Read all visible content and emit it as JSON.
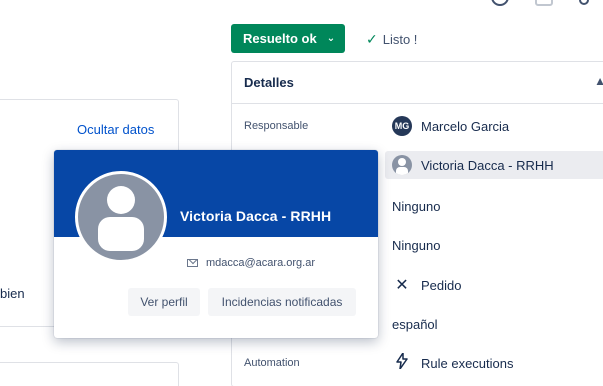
{
  "colors": {
    "status_bg": "#00875a",
    "card_banner": "#0747a6",
    "link": "#0052cc"
  },
  "status": {
    "label": "Resuelto ok",
    "chevron": "⌄"
  },
  "resolution": {
    "check": "✓",
    "label": "Listo !"
  },
  "left": {
    "hide_link": "Ocultar datos",
    "partial_text": "bien"
  },
  "details": {
    "title": "Detalles",
    "rows": {
      "responsable": {
        "label": "Responsable",
        "avatar": "MG",
        "value": "Marcelo Garcia"
      },
      "informador": {
        "value": "Victoria Dacca - RRHH"
      },
      "row3": {
        "value": "Ninguno"
      },
      "row4": {
        "value": "Ninguno"
      },
      "request_type": {
        "value": "Pedido",
        "icon": "tools-icon"
      },
      "language": {
        "value": "español"
      },
      "automation": {
        "label": "Automation",
        "value": "Rule executions",
        "icon": "bolt-icon"
      }
    }
  },
  "profile_card": {
    "name": "Victoria Dacca - RRHH",
    "email": "mdacca@acara.org.ar",
    "buttons": {
      "view_profile": "Ver perfil",
      "reported_issues": "Incidencias notificadas"
    }
  }
}
